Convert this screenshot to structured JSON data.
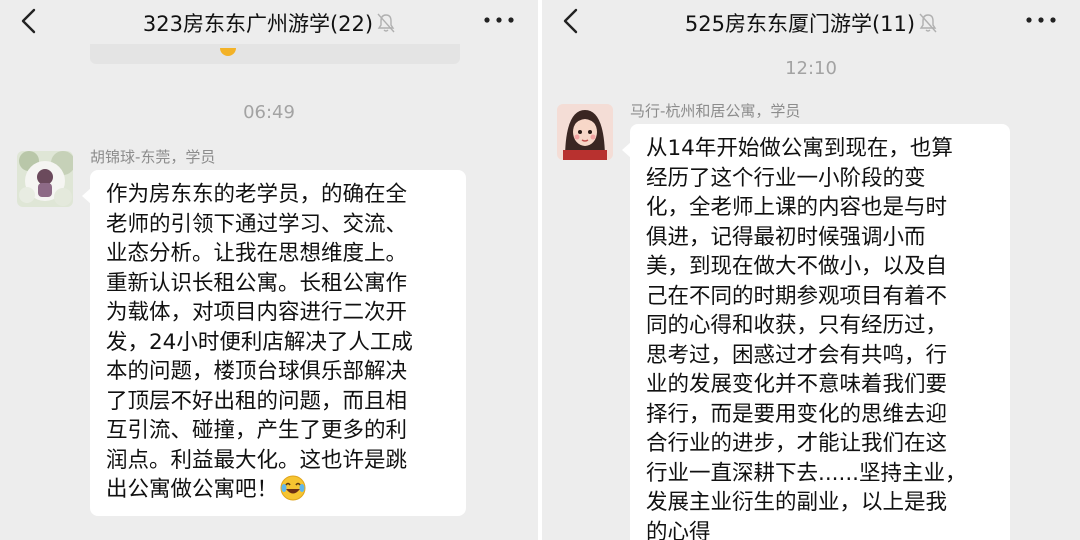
{
  "left_chat": {
    "title": "323房东东广州游学(22)",
    "timestamp": "06:49",
    "message": {
      "sender": "胡锦球-东莞，学员",
      "lines": [
        "作为房东东的老学员，的确在全",
        "老师的引领下通过学习、交流、",
        "业态分析。让我在思想维度上。",
        "重新认识长租公寓。长租公寓作",
        "为载体，对项目内容进行二次开",
        "发，24小时便利店解决了人工成",
        "本的问题，楼顶台球俱乐部解决",
        "了顶层不好出租的问题，而且相",
        "互引流、碰撞，产生了更多的利",
        "润点。利益最大化。这也许是跳",
        "出公寓做公寓吧！"
      ],
      "trailing_emoji": "laughing-tears-emoji"
    }
  },
  "right_chat": {
    "title": "525房东东厦门游学(11)",
    "timestamp": "12:10",
    "message": {
      "sender": "马行-杭州和居公寓，学员",
      "lines": [
        "从14年开始做公寓到现在，也算",
        "经历了这个行业一小阶段的变",
        "化，全老师上课的内容也是与时",
        "俱进，记得最初时候强调小而",
        "美，到现在做大不做小，以及自",
        "己在不同的时期参观项目有着不",
        "同的心得和收获，只有经历过，",
        "思考过，困惑过才会有共鸣，行",
        "业的发展变化并不意味着我们要",
        "择行，而是要用变化的思维去迎",
        "合行业的进步，才能让我们在这",
        "行业一直深耕下去......坚持主业，",
        "发展主业衍生的副业，以上是我",
        "的心得"
      ]
    }
  },
  "colors": {
    "chat_background": "#ededed",
    "bubble": "#ffffff",
    "meta_text": "#a3a3a3"
  }
}
